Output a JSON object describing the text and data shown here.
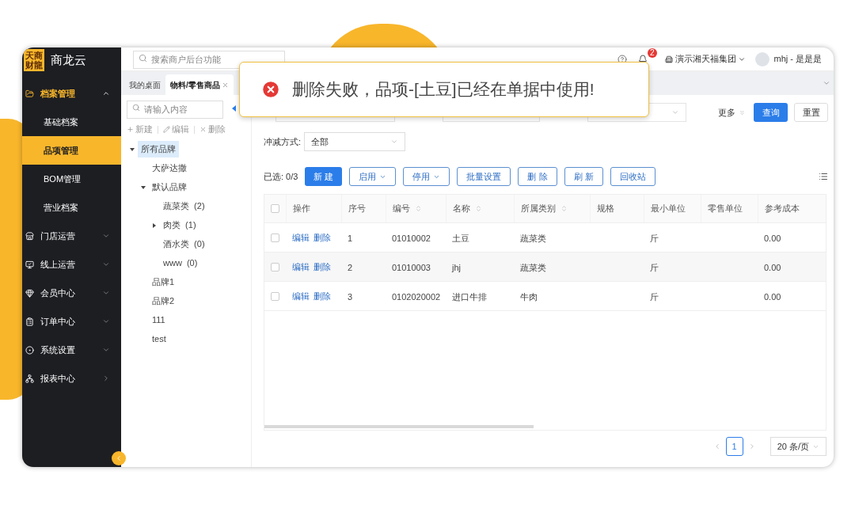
{
  "app": {
    "logo_text": [
      "天商",
      "财龍"
    ],
    "name": "商龙云"
  },
  "sidebar": {
    "items": [
      {
        "label": "档案管理",
        "kind": "group",
        "expanded": true,
        "children": [
          {
            "label": "基础档案",
            "selected": false
          },
          {
            "label": "品项管理",
            "selected": true
          },
          {
            "label": "BOM管理",
            "selected": false
          },
          {
            "label": "营业档案",
            "selected": false
          }
        ]
      },
      {
        "label": "门店运营",
        "kind": "group",
        "expanded": false
      },
      {
        "label": "线上运营",
        "kind": "group",
        "expanded": false
      },
      {
        "label": "会员中心",
        "kind": "group",
        "expanded": false
      },
      {
        "label": "订单中心",
        "kind": "group",
        "expanded": false
      },
      {
        "label": "系统设置",
        "kind": "group",
        "expanded": false
      },
      {
        "label": "报表中心",
        "kind": "link"
      }
    ]
  },
  "topbar": {
    "search_placeholder": "搜索商户后台功能",
    "notifications": "2",
    "company": "演示湘天福集团",
    "user": "mhj - 是是是"
  },
  "tabs": [
    {
      "label": "我的桌面",
      "selected": false,
      "closable": false
    },
    {
      "label": "物料/零售商品",
      "selected": true,
      "closable": true
    }
  ],
  "toast": {
    "kind": "error",
    "message": "删除失败，品项-[土豆]已经在单据中使用!"
  },
  "tree_panel": {
    "search_placeholder": "请输入内容",
    "actions": [
      {
        "label": "新建",
        "kind": "add"
      },
      {
        "label": "编辑",
        "kind": "edit"
      },
      {
        "label": "删除",
        "kind": "delete"
      }
    ],
    "tree": [
      {
        "label": "所有品牌",
        "selected": true,
        "expanded": true,
        "children": [
          {
            "label": "大萨达撒",
            "selected": false
          },
          {
            "label": "默认品牌",
            "selected": false,
            "expanded": true,
            "children": [
              {
                "label": "蔬菜类  (2)",
                "selected": false
              },
              {
                "label": "肉类  (1)",
                "selected": false,
                "expanded": false
              },
              {
                "label": "酒水类  (0)",
                "selected": false
              },
              {
                "label": "www  (0)",
                "selected": false
              }
            ]
          },
          {
            "label": "品牌1",
            "selected": false
          },
          {
            "label": "品牌2",
            "selected": false
          },
          {
            "label": "111",
            "selected": false
          },
          {
            "label": "test",
            "selected": false
          }
        ]
      }
    ]
  },
  "filters": {
    "more": "更多",
    "query": "查询",
    "reset": "重置",
    "deduct_label": "冲减方式:",
    "deduct_value": "全部"
  },
  "toolbar": {
    "selected_count": "已选: 0/3",
    "buttons": [
      {
        "label": "新 建",
        "kind": "primary"
      },
      {
        "label": "启用",
        "kind": "dropdown"
      },
      {
        "label": "停用",
        "kind": "dropdown"
      },
      {
        "label": "批量设置",
        "kind": "outline"
      },
      {
        "label": "删 除",
        "kind": "outline"
      },
      {
        "label": "刷 新",
        "kind": "outline"
      },
      {
        "label": "回收站",
        "kind": "outline"
      }
    ]
  },
  "table": {
    "all_checked": false,
    "action_column": "操作",
    "columns": [
      {
        "label": "序号",
        "sortable": false
      },
      {
        "label": "编号",
        "sortable": true
      },
      {
        "label": "名称",
        "sortable": true
      },
      {
        "label": "所属类别",
        "sortable": true
      },
      {
        "label": "规格",
        "sortable": false
      },
      {
        "label": "最小单位",
        "sortable": false
      },
      {
        "label": "零售单位",
        "sortable": false
      },
      {
        "label": "参考成本",
        "sortable": false
      }
    ],
    "rows": [
      {
        "checked": false,
        "actions": [
          "编辑",
          "删除"
        ],
        "cells": [
          "1",
          "01010002",
          "土豆",
          "蔬菜类",
          "",
          "斤",
          "",
          "0.00"
        ]
      },
      {
        "checked": false,
        "actions": [
          "编辑",
          "删除"
        ],
        "cells": [
          "2",
          "01010003",
          "jhj",
          "蔬菜类",
          "",
          "斤",
          "",
          "0.00"
        ]
      },
      {
        "checked": false,
        "actions": [
          "编辑",
          "删除"
        ],
        "cells": [
          "3",
          "0102020002",
          "进口牛排",
          "牛肉",
          "",
          "斤",
          "",
          "0.00"
        ]
      }
    ]
  },
  "pagination": {
    "pages": [
      {
        "label": "1",
        "selected": true
      }
    ],
    "page_size": "20 条/页"
  }
}
